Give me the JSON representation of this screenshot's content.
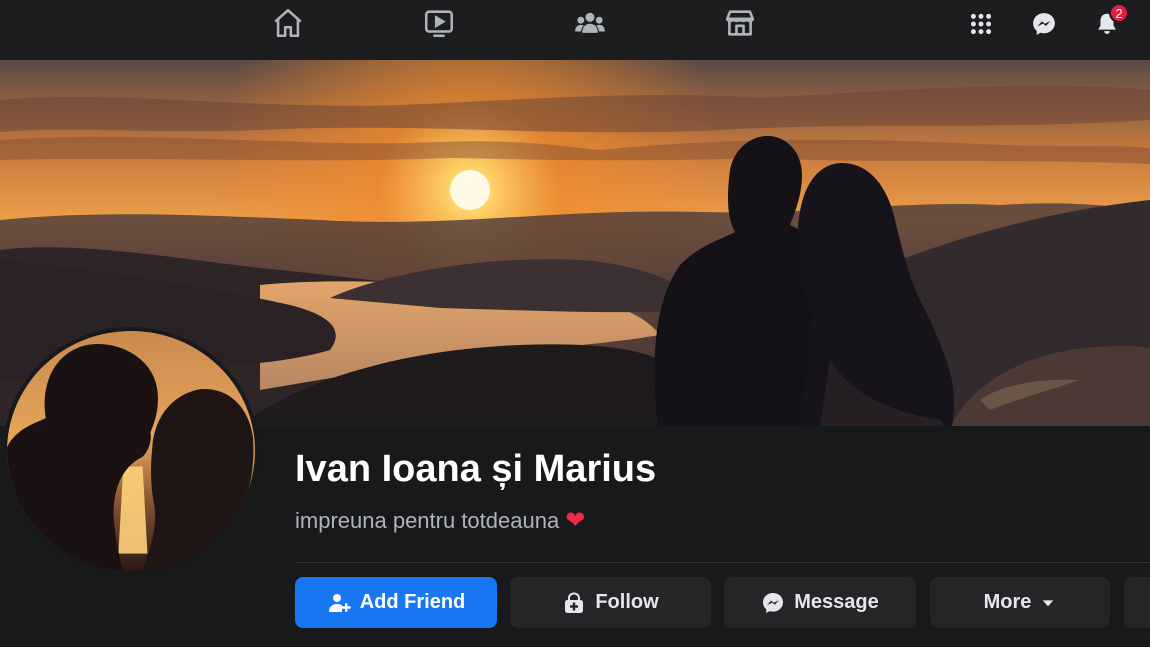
{
  "nav": {
    "icons": [
      "home-icon",
      "video-icon",
      "groups-icon",
      "marketplace-icon"
    ],
    "menu_icon": "grid-menu-icon",
    "messenger_icon": "messenger-icon",
    "notifications_icon": "bell-icon",
    "notifications_count": "2"
  },
  "profile": {
    "name": "Ivan Ioana și Marius",
    "bio": "impreuna pentru totdeauna",
    "bio_emoji": "❤"
  },
  "actions": {
    "add_friend": "Add Friend",
    "follow": "Follow",
    "message": "Message",
    "more": "More"
  },
  "colors": {
    "primary": "#1877f2",
    "badge": "#e41e3f",
    "background": "#18191a"
  }
}
